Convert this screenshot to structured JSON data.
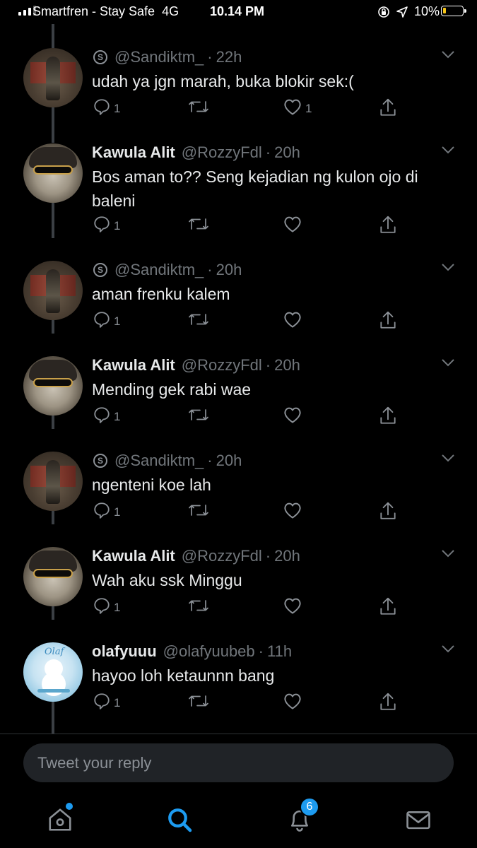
{
  "status_bar": {
    "carrier": "Smartfren - Stay Safe",
    "network": "4G",
    "time": "10.14 PM",
    "battery": "10%"
  },
  "tweets": [
    {
      "name": "",
      "handle": "@Sandiktm_",
      "time": "22h",
      "text": "udah ya jgn marah, buka blokir sek:(",
      "replies": "1",
      "retweets": "",
      "likes": "1"
    },
    {
      "name": "Kawula Alit",
      "handle": "@RozzyFdl",
      "time": "20h",
      "text": "Bos aman to?? Seng kejadian ng kulon ojo di baleni",
      "replies": "1",
      "retweets": "",
      "likes": ""
    },
    {
      "name": "",
      "handle": "@Sandiktm_",
      "time": "20h",
      "text": "aman frenku kalem",
      "replies": "1",
      "retweets": "",
      "likes": ""
    },
    {
      "name": "Kawula Alit",
      "handle": "@RozzyFdl",
      "time": "20h",
      "text": "Mending gek rabi wae",
      "replies": "1",
      "retweets": "",
      "likes": ""
    },
    {
      "name": "",
      "handle": "@Sandiktm_",
      "time": "20h",
      "text": "ngenteni koe lah",
      "replies": "1",
      "retweets": "",
      "likes": ""
    },
    {
      "name": "Kawula Alit",
      "handle": "@RozzyFdl",
      "time": "20h",
      "text": "Wah aku ssk Minggu",
      "replies": "1",
      "retweets": "",
      "likes": ""
    },
    {
      "name": "olafyuuu",
      "handle": "@olafyuubeb",
      "time": "11h",
      "text": "hayoo loh ketaunnn bang",
      "replies": "1",
      "retweets": "",
      "likes": ""
    }
  ],
  "avatar_labels": {
    "olaf": "Olaf"
  },
  "reply_box": {
    "placeholder": "Tweet your reply"
  },
  "tab_bar": {
    "notifications_badge": "6"
  },
  "colors": {
    "background": "#000000",
    "accent": "#1d9bf0",
    "muted": "#71767b"
  }
}
